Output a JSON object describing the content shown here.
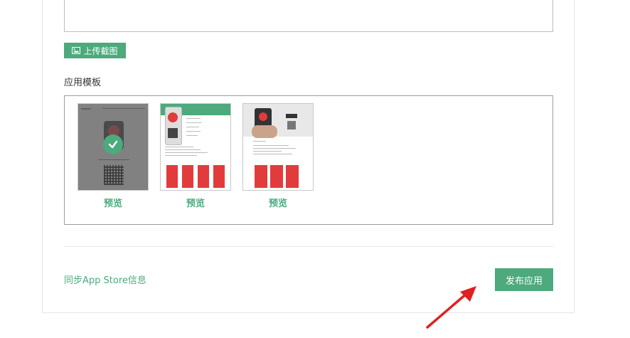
{
  "upload": {
    "label": "上传截图",
    "icon": "image-icon"
  },
  "templates": {
    "section_label": "应用模板",
    "items": [
      {
        "preview_label": "预览",
        "selected": true
      },
      {
        "preview_label": "预览",
        "selected": false
      },
      {
        "preview_label": "预览",
        "selected": false
      }
    ]
  },
  "footer": {
    "sync_link": "同步App Store信息",
    "publish_label": "发布应用"
  },
  "colors": {
    "accent": "#4caa7d",
    "arrow": "#e02020",
    "template_red": "#e23b3b"
  }
}
